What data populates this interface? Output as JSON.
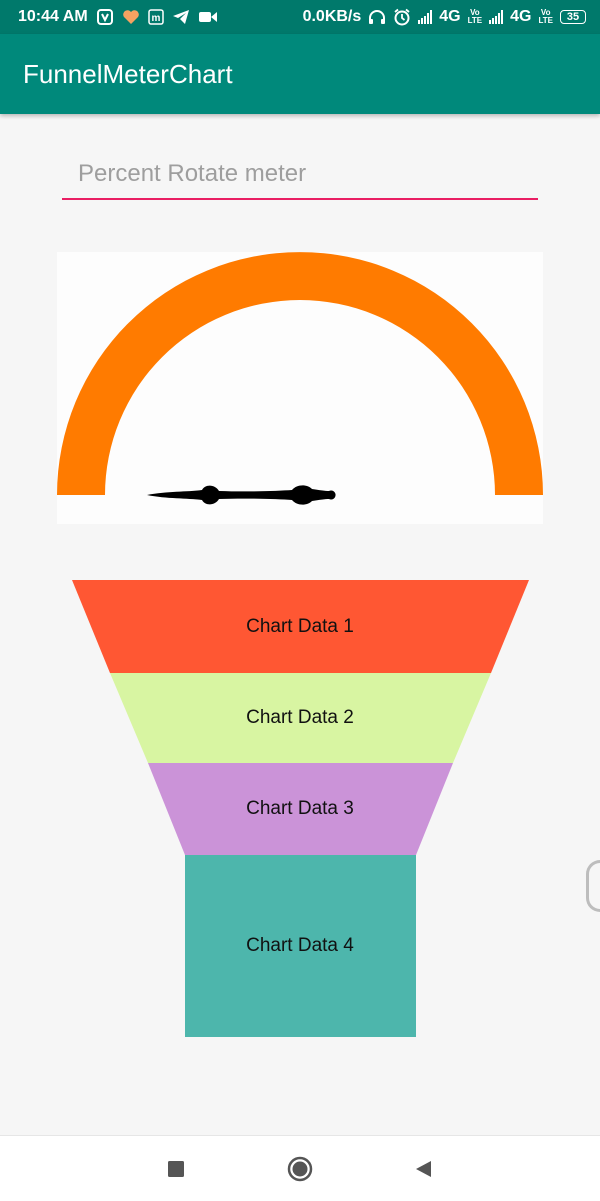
{
  "status_bar": {
    "time": "10:44 AM",
    "network_speed": "0.0KB/s",
    "signal_1_label": "4G",
    "signal_2_label": "4G",
    "volte_top": "Vo",
    "volte_bottom": "LTE",
    "battery": "35",
    "left_icons": [
      "sim-app-icon",
      "heart-icon",
      "m-app-icon",
      "telegram-icon",
      "video-camera-icon"
    ],
    "right_icons": [
      "headphones-icon",
      "alarm-icon"
    ]
  },
  "app_bar": {
    "title": "FunnelMeterChart"
  },
  "percent_input": {
    "value": "",
    "placeholder": "Percent Rotate meter"
  },
  "meter": {
    "arc_color": "#ff7b00",
    "needle_color": "#000000",
    "needle_percent": 0
  },
  "funnel": {
    "stages": [
      {
        "label": "Chart Data 1",
        "color": "#ff5733"
      },
      {
        "label": "Chart Data 2",
        "color": "#d8f5a2"
      },
      {
        "label": "Chart Data 3",
        "color": "#cb93d8"
      },
      {
        "label": "Chart Data 4",
        "color": "#4db6ac"
      }
    ]
  },
  "nav_bar": {
    "buttons": [
      "recents-button",
      "home-button",
      "back-button"
    ]
  }
}
